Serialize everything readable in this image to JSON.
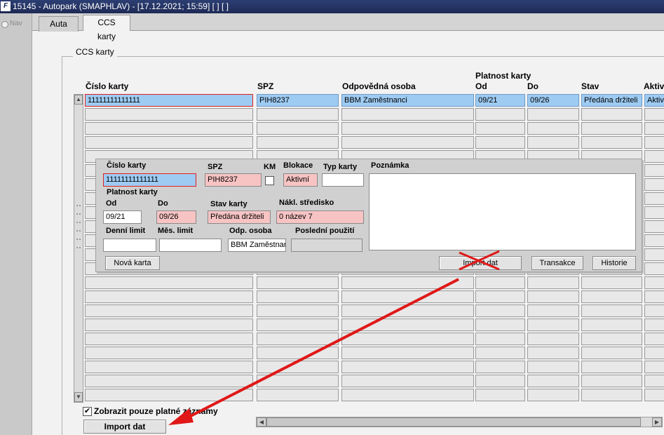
{
  "window": {
    "title": "15145 - Autopark (SMAPHLAV) - [17.12.2021; 15:59]  [ ]  [ ]",
    "icon": "app-logo-icon",
    "icon_glyph": "F"
  },
  "nav": {
    "label": "Nav"
  },
  "tabs": [
    {
      "label": "Auta"
    },
    {
      "label": "CCS karty"
    }
  ],
  "group": {
    "title": "CCS karty"
  },
  "table": {
    "headers": {
      "cislo": "Číslo karty",
      "spz": "SPZ",
      "osoba": "Odpovědná osoba",
      "platnost": "Platnost karty",
      "od": "Od",
      "do": "Do",
      "stav": "Stav",
      "aktiv": "Aktiv"
    },
    "rows": [
      {
        "cislo": "11111111111111",
        "spz": "PIH8237",
        "osoba": "BBM Zaměstnanci",
        "od": "09/21",
        "do": "09/26",
        "stav": "Předána držiteli",
        "aktiv": "Aktiv"
      }
    ]
  },
  "detail": {
    "labels": {
      "cislo": "Číslo karty",
      "spz": "SPZ",
      "km": "KM",
      "blokace": "Blokace",
      "typ": "Typ karty",
      "poznamka": "Poznámka",
      "platnost": "Platnost karty",
      "od": "Od",
      "do": "Do",
      "stav": "Stav karty",
      "nakl": "Nákl. středisko",
      "denni": "Denní limit",
      "mesicni": "Měs. limit",
      "odp": "Odp. osoba",
      "posledni": "Poslední použití"
    },
    "values": {
      "cislo": "11111111111111",
      "spz": "PIH8237",
      "blokace": "Aktivní",
      "typ": "",
      "od": "09/21",
      "do": "09/26",
      "stav": "Předána držiteli",
      "nakl": "0 název 7",
      "denni": "",
      "mesicni": "",
      "odp": "BBM Zaměstnan",
      "posledni": "",
      "poznamka": ""
    },
    "buttons": {
      "nova": "Nová karta",
      "import": "Import dat",
      "transakce": "Transakce",
      "historie": "Historie"
    }
  },
  "footer": {
    "checkbox_label": "Zobrazit pouze platné záznamy",
    "checkbox_mark": "✔",
    "import_button": "Import dat"
  },
  "scroll": {
    "up": "▲",
    "down": "▼",
    "left": "◀",
    "right": "▶"
  },
  "annotation": {
    "arrow_color": "#e01818",
    "cross_color": "#e01818"
  }
}
